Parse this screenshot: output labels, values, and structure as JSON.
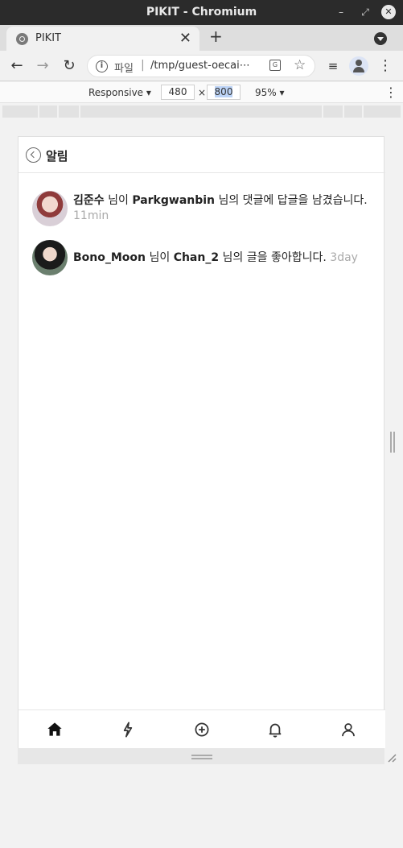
{
  "window": {
    "title": "PIKIT - Chromium"
  },
  "tab": {
    "title": "PIKIT"
  },
  "omnibox": {
    "scheme": "파일",
    "url": "/tmp/guest-oecai⋯"
  },
  "device": {
    "mode": "Responsive",
    "width": "480",
    "height": "800",
    "zoom": "95%"
  },
  "app": {
    "header": {
      "title": "알림"
    },
    "notifications": [
      {
        "user": "김준수",
        "p1": " 님이 ",
        "target": "Parkgwanbin",
        "p2": " 님의 댓글에 답글을 남겼습니다.",
        "time": "11min"
      },
      {
        "user": "Bono_Moon",
        "p1": " 님이 ",
        "target": "Chan_2",
        "p2": " 님의 글을 좋아합니다.",
        "time": "3day"
      }
    ],
    "nav": [
      "home-icon",
      "bolt-icon",
      "add-circle-icon",
      "bell-icon",
      "person-icon"
    ]
  },
  "colors": {
    "titlebar": "#2b2b2b",
    "muted_time": "#aaaaaa",
    "text": "#222222"
  }
}
